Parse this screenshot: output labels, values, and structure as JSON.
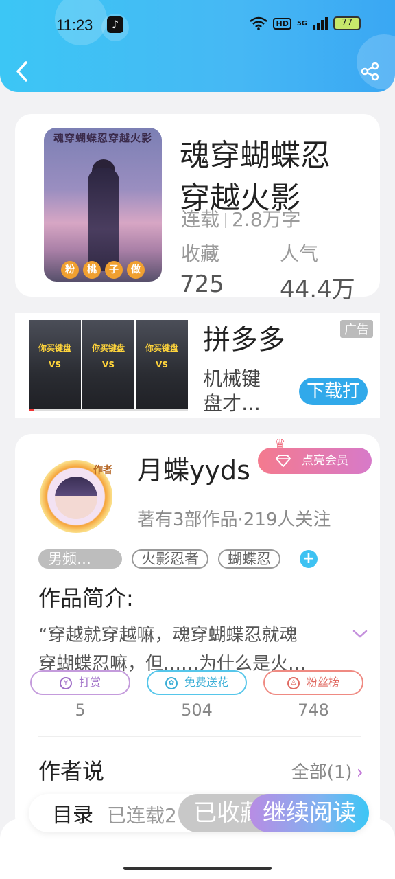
{
  "status_bar": {
    "time": "11:23",
    "hd": "HD",
    "net": "5G",
    "battery": "77"
  },
  "book": {
    "title_line1": "魂穿蝴蝶忍",
    "title_line2": "穿越火影",
    "status": "连载",
    "words": "2.8万字",
    "collect_label": "收藏",
    "collect_value": "725",
    "popularity_label": "人气",
    "popularity_value": "44.4万",
    "cover_title": "魂穿蝴蝶忍穿越火影",
    "cover_author_chars": [
      "粉",
      "桃",
      "子",
      "做"
    ]
  },
  "ad": {
    "name": "拼多多",
    "tag": "广告",
    "desc": "机械键盘才…",
    "button": "下载打",
    "thumb_text1": "你买键盘",
    "thumb_text2": "VS"
  },
  "author": {
    "name": "月蝶yyds",
    "badge": "作者",
    "vip_label": "点亮会员",
    "meta": "著有3部作品·219人关注",
    "tags": [
      "男频…",
      "火影忍者",
      "蝴蝶忍"
    ]
  },
  "intro": {
    "heading": "作品简介:",
    "line1": "“穿越就穿越嘛，魂穿蝴蝶忍就魂",
    "line2": "穿蝴蝶忍嘛，但……为什么是火…"
  },
  "actions": [
    {
      "label": "打赏",
      "count": "5"
    },
    {
      "label": "免费送花",
      "count": "504"
    },
    {
      "label": "粉丝榜",
      "count": "748"
    }
  ],
  "author_says": {
    "heading": "作者说",
    "all": "全部(1)"
  },
  "dock": {
    "toc": "目录",
    "toc_sub": "已连载2",
    "collected": "已收藏",
    "continue": "继续阅读"
  },
  "colors": {
    "header": "#3cc6f5",
    "accent_blue": "#3ec2f2",
    "vip_pink": "#f47a8e"
  }
}
